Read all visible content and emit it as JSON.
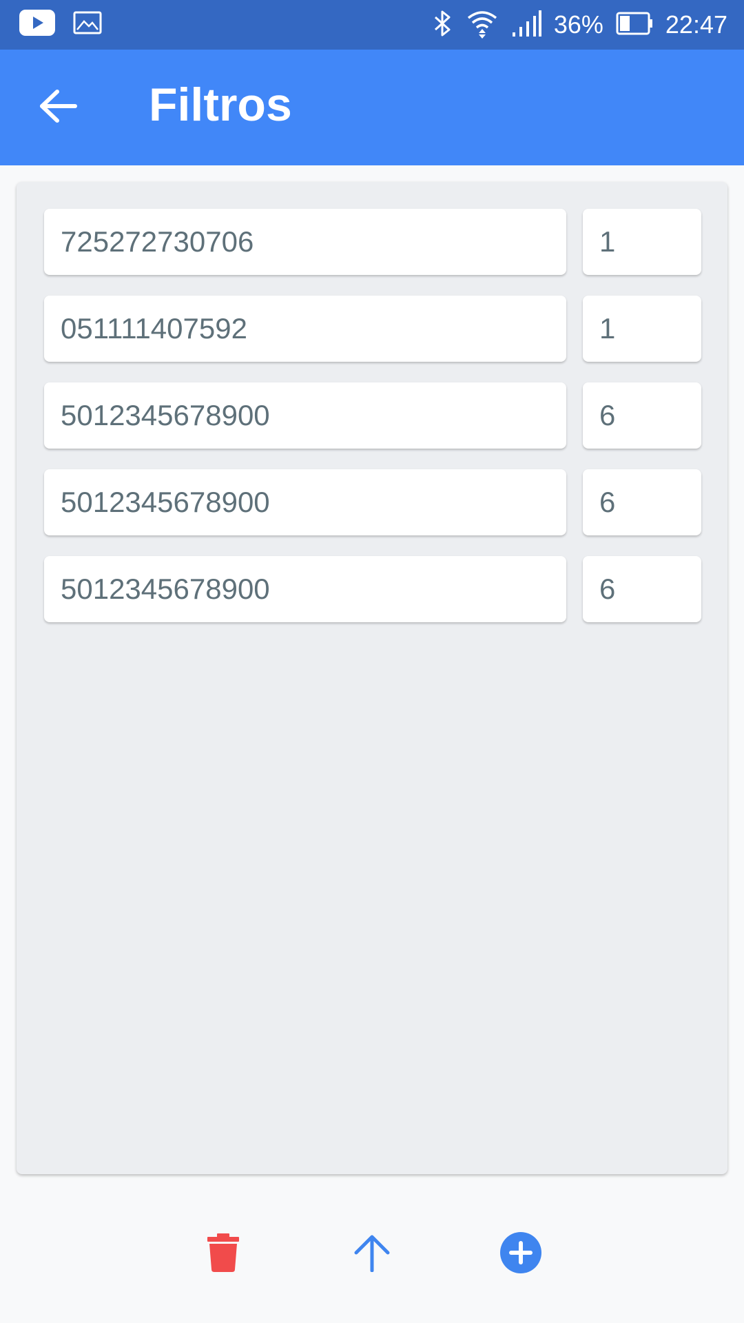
{
  "status_bar": {
    "battery": "36%",
    "time": "22:47"
  },
  "header": {
    "title": "Filtros"
  },
  "filters": [
    {
      "code": "725272730706",
      "qty": "1"
    },
    {
      "code": "051111407592",
      "qty": "1"
    },
    {
      "code": "5012345678900",
      "qty": "6"
    },
    {
      "code": "5012345678900",
      "qty": "6"
    },
    {
      "code": "5012345678900",
      "qty": "6"
    }
  ],
  "colors": {
    "status_bar": "#3468c2",
    "app_bar": "#4187f8",
    "delete": "#f14b4b",
    "accent": "#3f85ef"
  },
  "icons": {
    "back": "arrow-left-icon",
    "delete": "trash-icon",
    "upload": "arrow-up-icon",
    "add": "add-circle-icon"
  }
}
